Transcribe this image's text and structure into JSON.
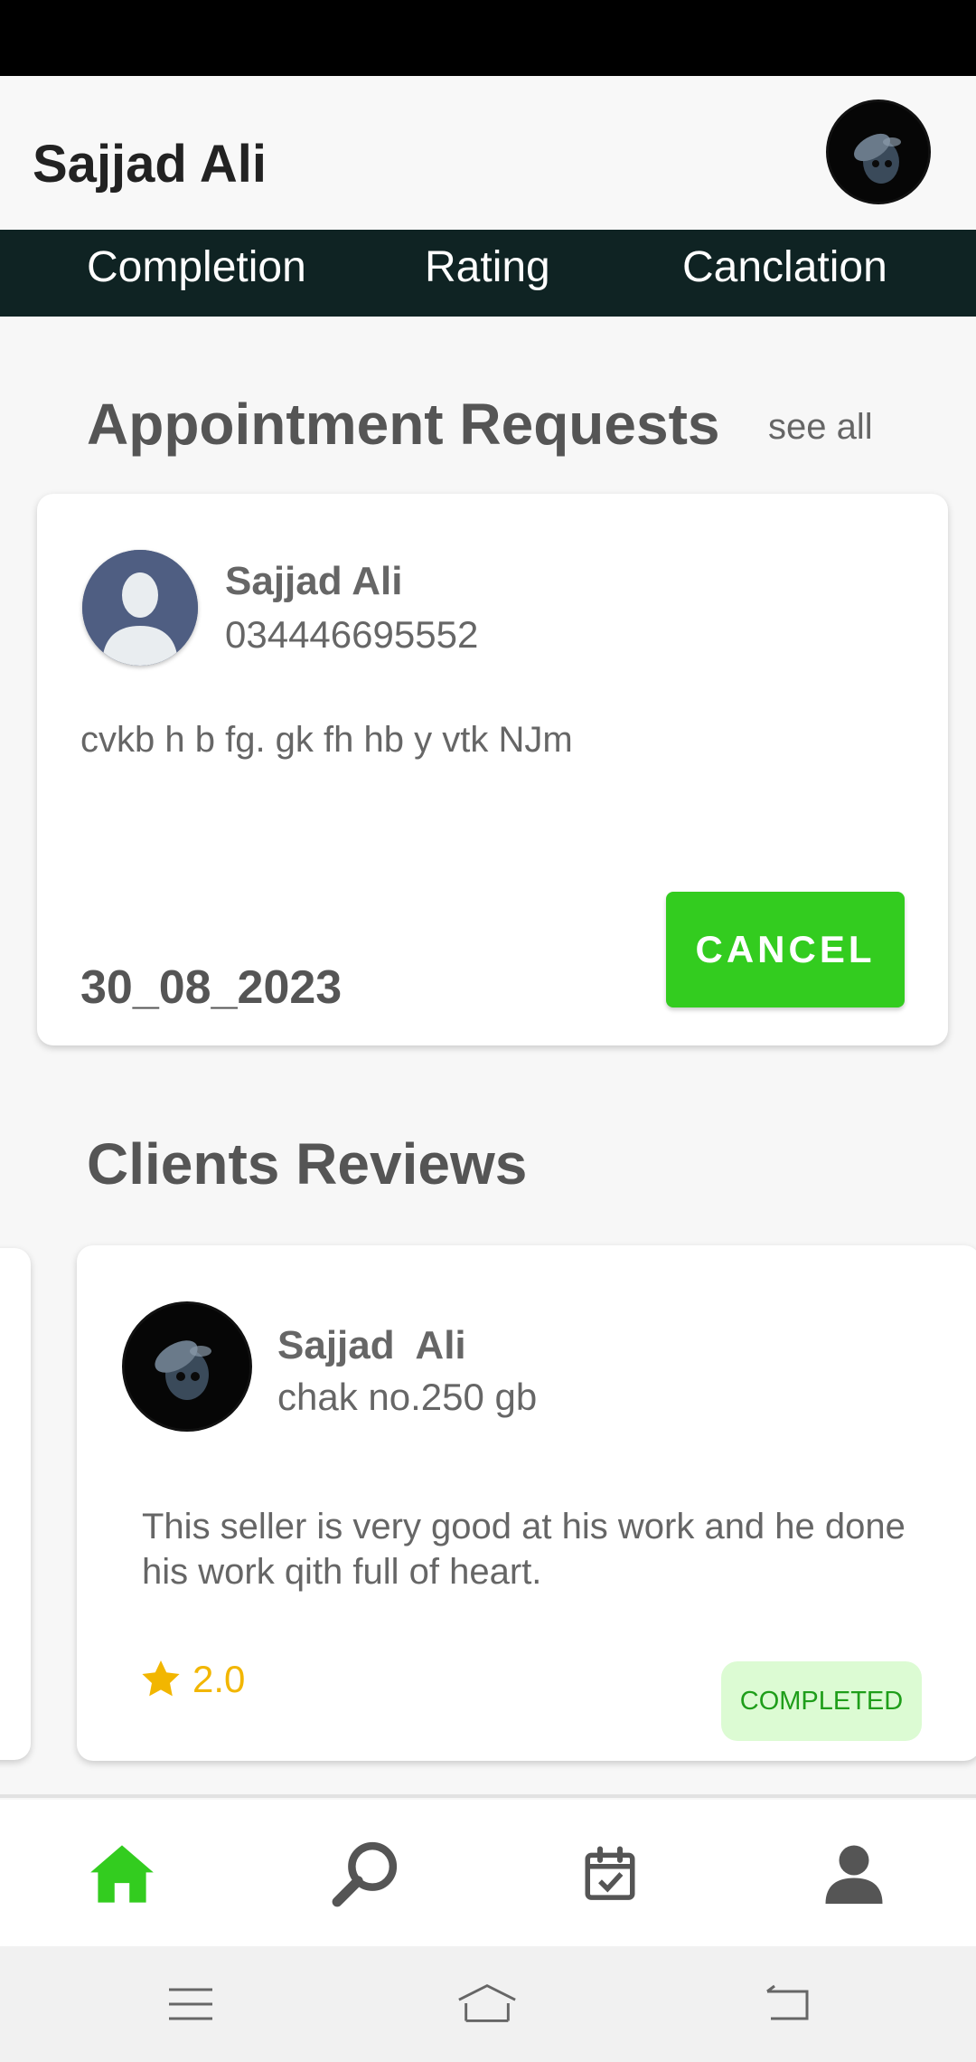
{
  "header": {
    "title": "Sajjad Ali"
  },
  "stats": {
    "labels": [
      "Completion",
      "Rating",
      "Canclation"
    ]
  },
  "appointments": {
    "section_title": "Appointment Requests",
    "see_all_label": "see all",
    "card": {
      "name": "Sajjad Ali",
      "phone": "034446695552",
      "message": "cvkb h b fg. gk fh hb y vtk NJm",
      "date": "30_08_2023",
      "cancel_label": "CANCEL"
    }
  },
  "reviews": {
    "section_title": "Clients Reviews",
    "card": {
      "name": "Sajjad  Ali",
      "address": "chak no.250 gb",
      "text": "This seller is very good at his work and he done his work qith full of heart.",
      "rating": "2.0",
      "status": "COMPLETED"
    }
  },
  "bottom_nav": {
    "items": [
      {
        "icon": "home-icon",
        "active": true
      },
      {
        "icon": "search-icon",
        "active": false
      },
      {
        "icon": "calendar-check-icon",
        "active": false
      },
      {
        "icon": "profile-icon",
        "active": false
      }
    ]
  },
  "colors": {
    "accent_green": "#33cc1f",
    "stats_band": "#0f2323",
    "star": "#f2b600",
    "chip_bg": "#dcfbd3",
    "chip_text": "#1f9e1a"
  }
}
